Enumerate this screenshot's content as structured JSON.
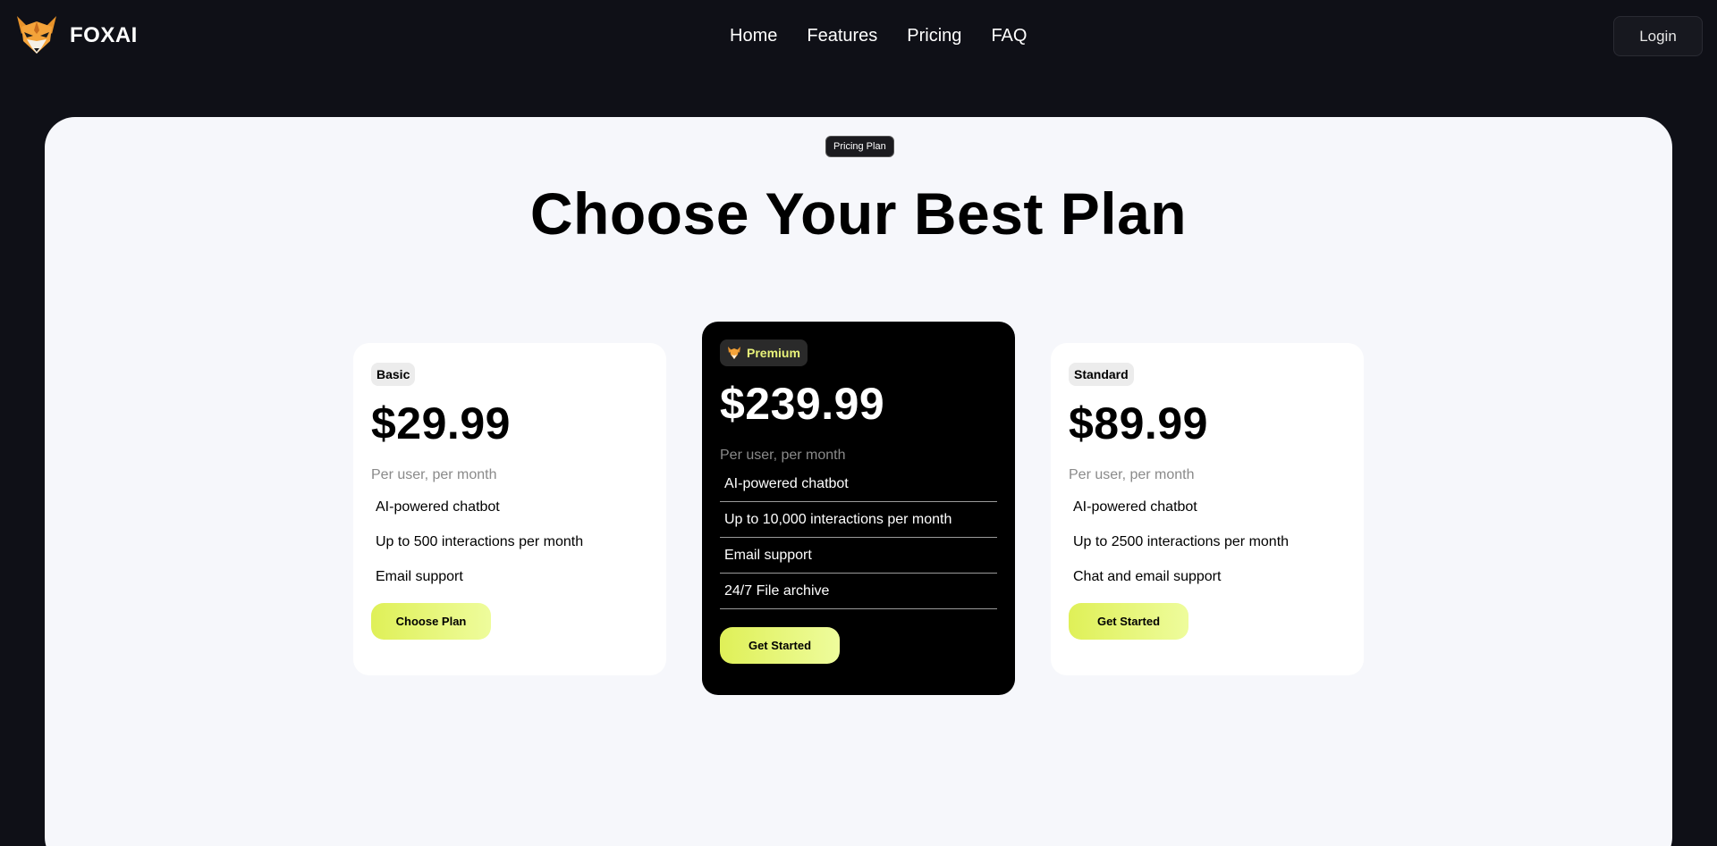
{
  "header": {
    "brand": "FOXAI",
    "nav": [
      {
        "label": "Home"
      },
      {
        "label": "Features"
      },
      {
        "label": "Pricing"
      },
      {
        "label": "FAQ"
      }
    ],
    "login_label": "Login"
  },
  "main": {
    "tag": "Pricing Plan",
    "title": "Choose Your Best Plan"
  },
  "plans": [
    {
      "badge": "Basic",
      "price": "$29.99",
      "period": "Per user, per month",
      "features": [
        "AI-powered chatbot",
        "Up to 500 interactions per month",
        "Email support"
      ],
      "cta": "Choose Plan"
    },
    {
      "badge": "Premium",
      "price": "$239.99",
      "period": "Per user, per month",
      "features": [
        "AI-powered chatbot",
        "Up to 10,000 interactions per month",
        "Email support",
        "24/7 File archive"
      ],
      "cta": "Get Started"
    },
    {
      "badge": "Standard",
      "price": "$89.99",
      "period": "Per user, per month",
      "features": [
        "AI-powered chatbot",
        "Up to 2500 interactions per month",
        "Chat and email support"
      ],
      "cta": "Get Started"
    }
  ],
  "icons": {
    "logo": "fox-logo-icon",
    "premium_badge": "fox-icon"
  },
  "colors": {
    "page_bg": "#0f1017",
    "panel_bg": "#f6f7fb",
    "accent": "#dff058",
    "premium_card": "#000000"
  }
}
